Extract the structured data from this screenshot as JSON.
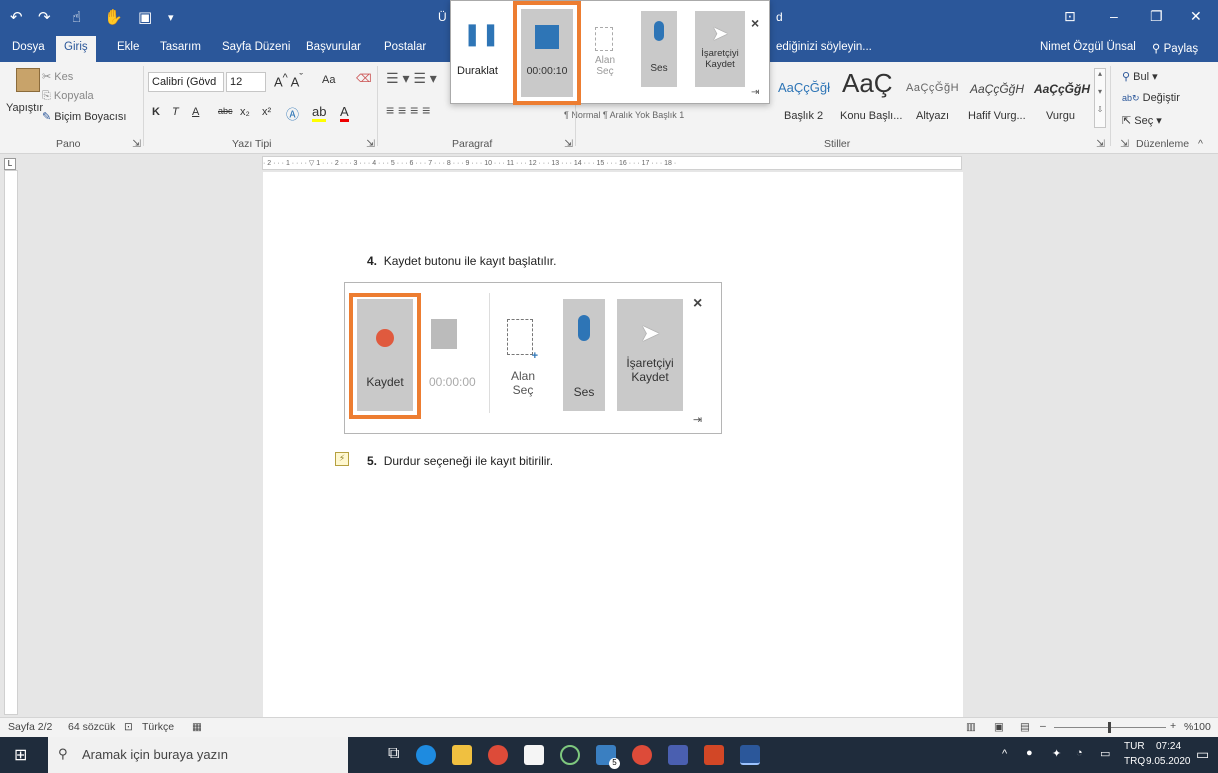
{
  "window": {
    "title_fragment": "Ü",
    "title_fragment_right": "d",
    "user_name": "Nimet Özgül Ünsal",
    "share_label": "Paylaş"
  },
  "tabs": [
    {
      "label": "Dosya",
      "active": false
    },
    {
      "label": "Giriş",
      "active": true
    },
    {
      "label": "Ekle",
      "active": false
    },
    {
      "label": "Tasarım",
      "active": false
    },
    {
      "label": "Sayfa Düzeni",
      "active": false
    },
    {
      "label": "Başvurular",
      "active": false
    },
    {
      "label": "Postalar",
      "active": false
    }
  ],
  "tell_me_placeholder": "ediğinizi söyleyin...",
  "ribbon": {
    "clipboard": {
      "paste": "Yapıştır",
      "cut": "Kes",
      "copy": "Kopyala",
      "format_painter": "Biçim Boyacısı",
      "group": "Pano"
    },
    "font": {
      "name": "Calibri (Gövd",
      "size": "12",
      "case": "Aa",
      "bold": "K",
      "italic": "T",
      "underline": "A",
      "strike": "abc",
      "subscript": "x₂",
      "superscript": "x²",
      "group": "Yazı Tipi"
    },
    "paragraph": {
      "group": "Paragraf",
      "partial_styles": "¶ Normal   ¶ Aralık Yok   Başlık 1"
    },
    "styles": {
      "group": "Stiller",
      "items": [
        {
          "preview": "AaÇçĞğł",
          "label": "Başlık 2"
        },
        {
          "preview": "AaÇ",
          "label": "Konu Başlı..."
        },
        {
          "preview": "AaÇçĞğH",
          "label": "Altyazı"
        },
        {
          "preview": "AaÇçĞğH",
          "label": "Hafif Vurg..."
        },
        {
          "preview": "AaÇçĞğH",
          "label": "Vurgu"
        }
      ]
    },
    "editing": {
      "find": "Bul",
      "replace": "Değiştir",
      "select": "Seç",
      "group": "Düzenleme"
    }
  },
  "rec_toolbar": {
    "pause": "Duraklat",
    "time": "00:00:10",
    "area": "Alan Seç",
    "audio": "Ses",
    "pointer": "İşaretçiyi Kaydet",
    "close": "×"
  },
  "document": {
    "item4_num": "4.",
    "item4_text": "Kaydet butonu ile kayıt başlatılır.",
    "item5_num": "5.",
    "item5_text": "Durdur seçeneği ile kayıt bitirilir.",
    "embed": {
      "record": "Kaydet",
      "time": "00:00:00",
      "area": "Alan Seç",
      "audio": "Ses",
      "pointer": "İşaretçiyi Kaydet",
      "close": "×"
    }
  },
  "status": {
    "page": "Sayfa 2/2",
    "words": "64 sözcük",
    "language": "Türkçe",
    "zoom": "%100"
  },
  "taskbar": {
    "search_placeholder": "Aramak için buraya yazın",
    "lang_top": "TUR",
    "lang_bottom": "TRQ",
    "time": "07:24",
    "date": "9.05.2020",
    "mail_badge": "5"
  },
  "colors": {
    "word_blue": "#2b579a",
    "highlight_orange": "#ed7d31",
    "record_red": "#e05a3e",
    "stop_blue": "#2e75b6"
  }
}
